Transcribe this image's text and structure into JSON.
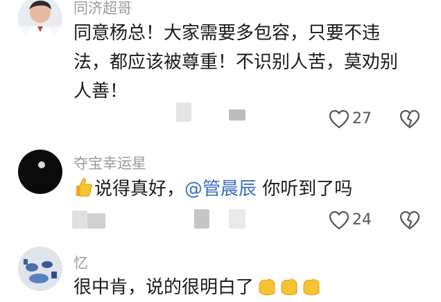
{
  "comments": [
    {
      "username": "同济超哥",
      "text": "同意杨总！大家需要多包容，只要不违法，都应该被尊重！不识别人苦，莫劝别人善！",
      "likes": "27"
    },
    {
      "username": "夺宝幸运星",
      "text_before": "说得真好，",
      "mention": "@管晨辰",
      "text_after": " 你听到了吗",
      "likes": "24"
    },
    {
      "username": "忆",
      "text": "很中肯，说的很明白了"
    }
  ],
  "icons": {
    "like": "heart-outline-icon",
    "dislike": "broken-heart-icon",
    "thumbs_up": "thumbs-up-emoji",
    "fist": "fist-emoji"
  },
  "colors": {
    "username": "#9a9a9a",
    "text": "#1a1a1a",
    "mention": "#3b6cc0",
    "icon": "#555555"
  }
}
